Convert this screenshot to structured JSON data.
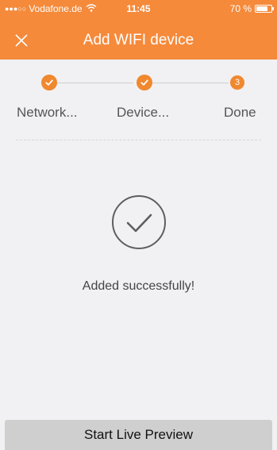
{
  "status_bar": {
    "signal_dots": "●●●○○",
    "carrier": "Vodafone.de",
    "wifi_icon": "wifi-icon",
    "time": "11:45",
    "battery": "70 %"
  },
  "header": {
    "title": "Add WIFI device",
    "close_icon": "close-icon"
  },
  "stepper": {
    "steps": [
      {
        "label": "Network...",
        "state": "done"
      },
      {
        "label": "Device...",
        "state": "done"
      },
      {
        "label": "Done",
        "state": "current",
        "number": "3"
      }
    ]
  },
  "result": {
    "message": "Added successfully!",
    "icon": "check-circle-icon"
  },
  "actions": {
    "start_live_preview_label": "Start Live Preview"
  },
  "colors": {
    "accent": "#f58a3b",
    "background": "#f1f1f3",
    "button": "#cfcfcf"
  }
}
